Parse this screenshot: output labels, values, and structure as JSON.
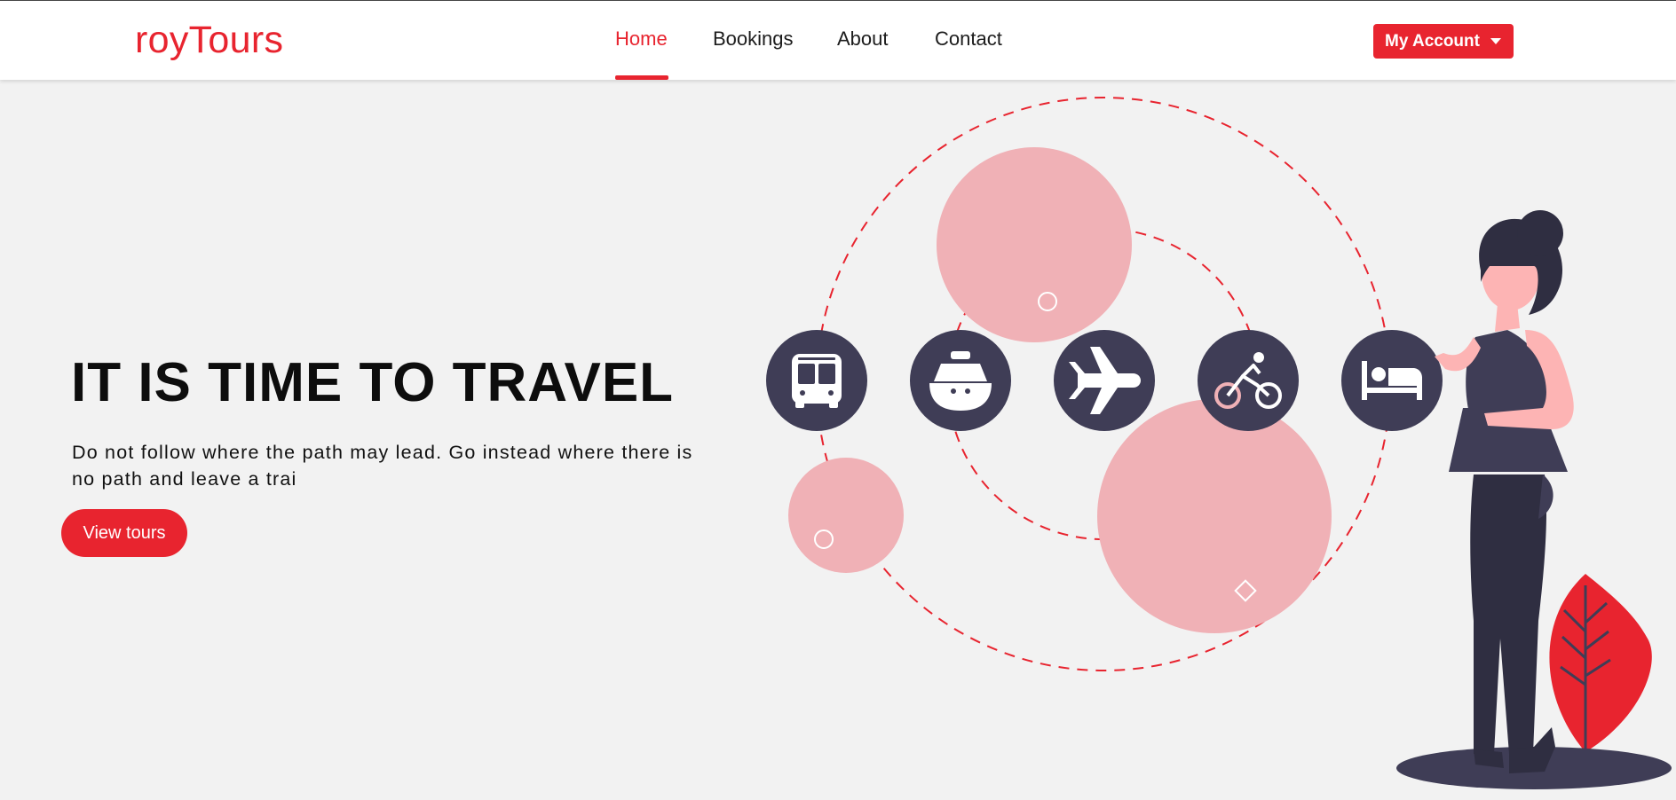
{
  "nav": {
    "brand": "royTours",
    "links": [
      {
        "label": "Home",
        "active": true
      },
      {
        "label": "Bookings",
        "active": false
      },
      {
        "label": "About",
        "active": false
      },
      {
        "label": "Contact",
        "active": false
      }
    ],
    "account_label": "My Account"
  },
  "hero": {
    "title": "IT IS TIME TO TRAVEL",
    "text": "Do not follow where the path may lead. Go instead where there is no path and leave a trai",
    "cta_label": "View tours"
  },
  "illustration": {
    "icons": [
      "bus-icon",
      "ship-icon",
      "airplane-icon",
      "bicycle-icon",
      "bed-icon"
    ]
  },
  "colors": {
    "accent": "#e8242f",
    "icon_circle": "#3f3d56",
    "pink": "#f0b1b6",
    "background": "#f2f2f2"
  }
}
